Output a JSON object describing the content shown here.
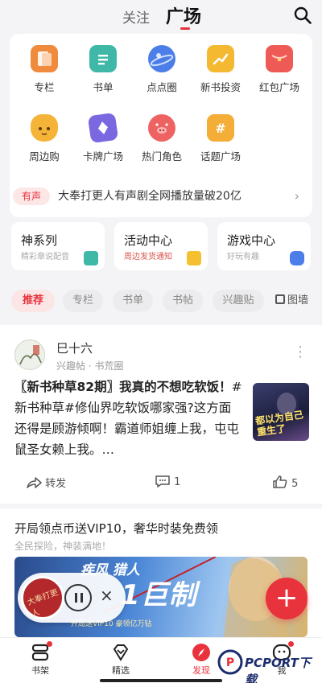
{
  "header": {
    "tab_follow": "关注",
    "tab_square": "广场"
  },
  "grid": {
    "items": [
      {
        "label": "专栏",
        "icon": "column-icon",
        "color": "#f08a3c"
      },
      {
        "label": "书单",
        "icon": "booklist-icon",
        "color": "#3fb8a7"
      },
      {
        "label": "点点圈",
        "icon": "planet-icon",
        "color": "#4b7ee8"
      },
      {
        "label": "新书投资",
        "icon": "invest-icon",
        "color": "#f4b930"
      },
      {
        "label": "红包广场",
        "icon": "red-packet-icon",
        "color": "#ee5b56"
      },
      {
        "label": "周边购",
        "icon": "fox-icon",
        "color": "#f5b437"
      },
      {
        "label": "卡牌广场",
        "icon": "card-icon",
        "color": "#7a68e0"
      },
      {
        "label": "热门角色",
        "icon": "pig-icon",
        "color": "#ef6262"
      },
      {
        "label": "话题广场",
        "icon": "topic-icon",
        "color": "#f4ad36"
      }
    ]
  },
  "notice": {
    "badge": "有声",
    "text": "大奉打更人有声剧全网播放量破20亿"
  },
  "cards": [
    {
      "title": "神系列",
      "sub": "精彩章说配音",
      "deco_color": "#3fb8a7"
    },
    {
      "title": "活动中心",
      "sub": "周边发货通知",
      "deco_color": "#f4c030"
    },
    {
      "title": "游戏中心",
      "sub": "好玩有趣",
      "deco_color": "#4b7ee8"
    }
  ],
  "chips": {
    "items": [
      "推荐",
      "专栏",
      "书单",
      "书帖",
      "兴趣贴"
    ],
    "grid_label": "图墙"
  },
  "post": {
    "author": "巳十六",
    "source": "兴趣帖 · 书荒圈",
    "title": "〖新书种草82期〗我真的不想吃软饭！",
    "body": "#新书种草#修仙界吃软饭哪家强?这方面还得是顾游倾啊！霸道师姐缠上我，屯屯鼠圣女赖上我。…",
    "thumb_text": "都以为自己重生了",
    "share_label": "转发",
    "comment_count": "1",
    "like_count": "5"
  },
  "ad": {
    "title": "开局领点币送VIP10，奢华时装免费领",
    "sub": "全民探险，神装满地！",
    "game_name": "疾风 猎人",
    "big_text": "1巨制",
    "small_text": "开局送VIP10  豪领亿万钻"
  },
  "player": {
    "disc_text": "大奉打更人"
  },
  "nav": {
    "items": [
      {
        "label": "书架",
        "icon": "bookshelf-icon"
      },
      {
        "label": "精选",
        "icon": "diamond-icon"
      },
      {
        "label": "发现",
        "icon": "compass-icon"
      },
      {
        "label": "我",
        "icon": "face-icon"
      }
    ]
  },
  "watermark": {
    "text": "PCPORT下载"
  }
}
